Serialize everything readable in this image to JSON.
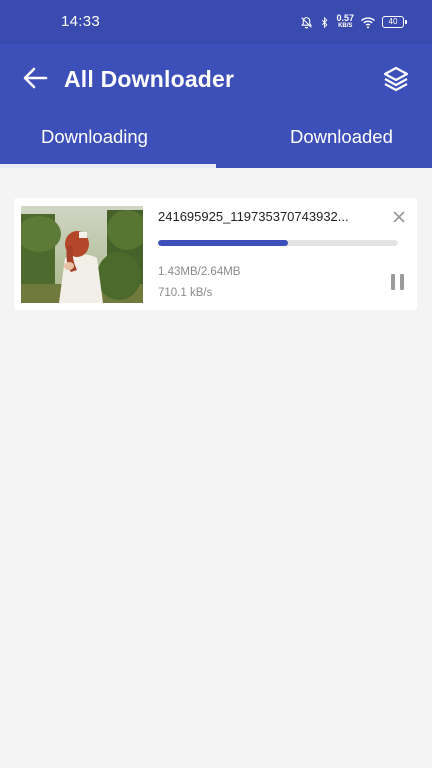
{
  "status_bar": {
    "time": "14:33",
    "net_speed": "0.57",
    "net_unit": "KB/S",
    "battery": "40",
    "icons": [
      "bell-off-icon",
      "bluetooth-icon",
      "wifi-icon",
      "battery-icon"
    ]
  },
  "app_bar": {
    "title": "All Downloader",
    "back_icon": "arrow-left-icon",
    "action_icon": "layers-icon"
  },
  "tabs": [
    {
      "label": "Downloading",
      "selected": true
    },
    {
      "label": "Downloaded",
      "selected": false
    }
  ],
  "downloads": [
    {
      "file_name": "241695925_119735370743932...",
      "size": "1.43MB/2.64MB",
      "speed": "710.1 kB/s",
      "progress": 0.542,
      "thumbnail": "woman-in-white-dress-in-garden"
    }
  ],
  "colors": {
    "primary": "#3d4fb8",
    "status_bar": "#3a4bb0",
    "background": "#f4f4f4"
  }
}
